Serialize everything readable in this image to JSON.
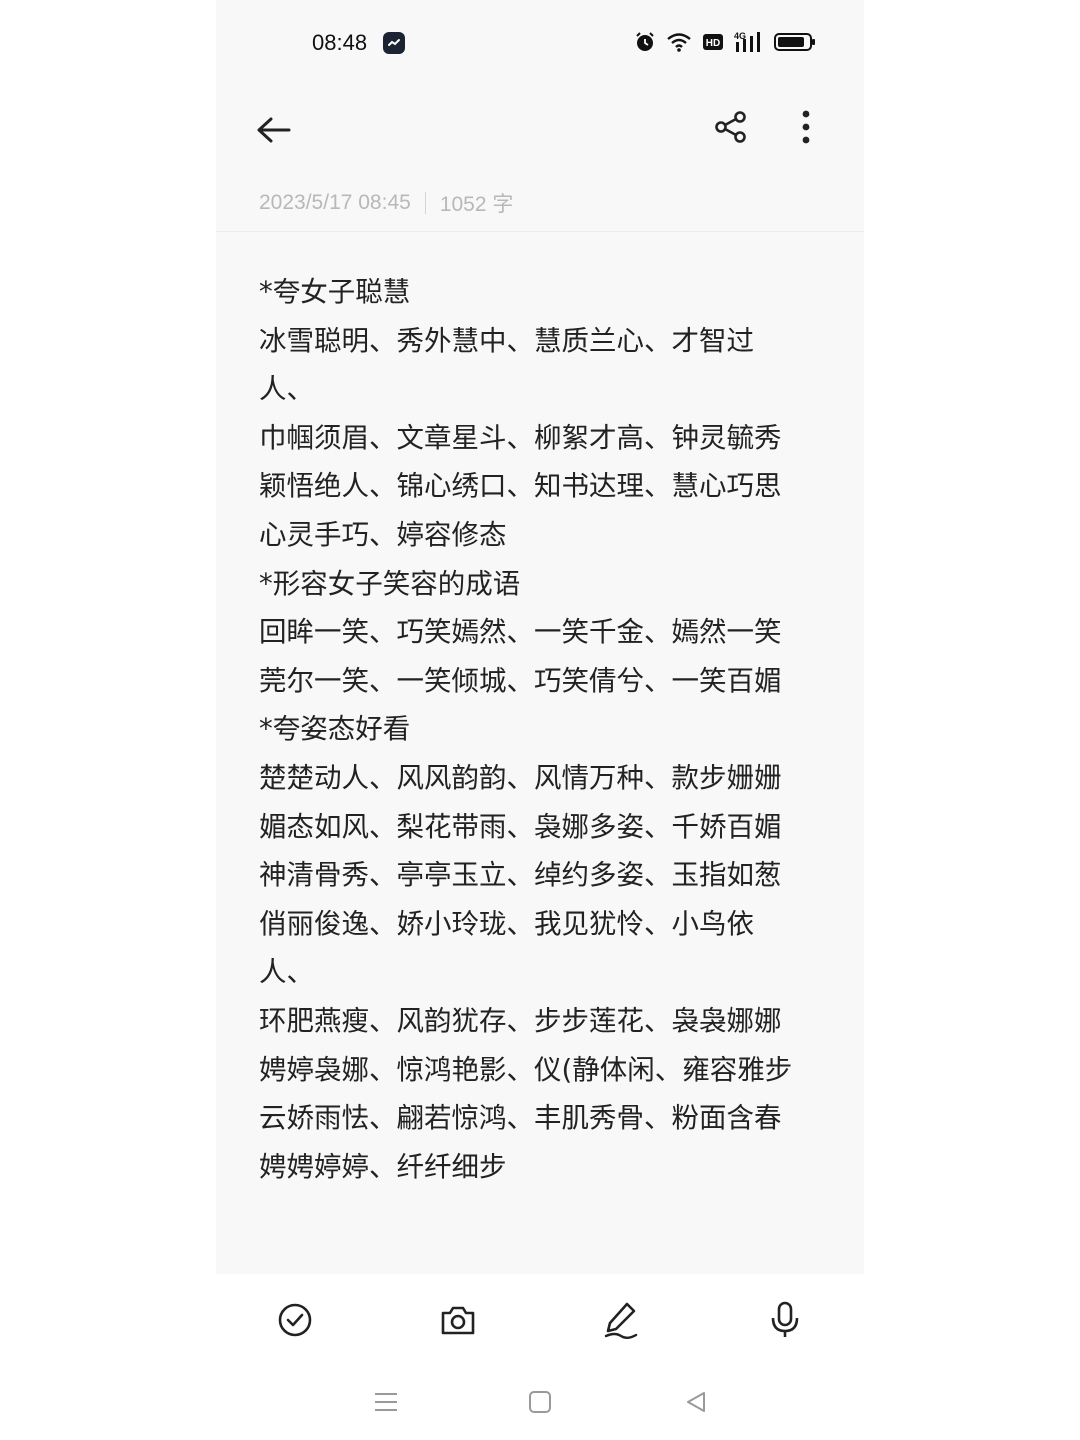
{
  "status_bar": {
    "time": "08:48",
    "icons": [
      "alarm-icon",
      "wifi-icon",
      "hd-icon",
      "4g-signal-icon",
      "battery-icon"
    ],
    "hd_label": "HD",
    "network_label": "4G"
  },
  "top_bar": {
    "back_icon": "back-arrow-icon",
    "share_icon": "share-icon",
    "more_icon": "more-vertical-icon"
  },
  "meta": {
    "datetime": "2023/5/17 08:45",
    "word_count": "1052 字"
  },
  "note": {
    "lines": [
      "*夸女子聪慧",
      "冰雪聪明、秀外慧中、慧质兰心、才智过",
      "人、",
      "巾帼须眉、文章星斗、柳絮才高、钟灵毓秀",
      "颖悟绝人、锦心绣口、知书达理、慧心巧思",
      "心灵手巧、婷容修态",
      "*形容女子笑容的成语",
      "回眸一笑、巧笑嫣然、一笑千金、嫣然一笑",
      "莞尔一笑、一笑倾城、巧笑倩兮、一笑百媚",
      "*夸姿态好看",
      "楚楚动人、风风韵韵、风情万种、款步姗姗",
      "媚态如风、梨花带雨、袅娜多姿、千娇百媚",
      "神清骨秀、亭亭玉立、绰约多姿、玉指如葱",
      "俏丽俊逸、娇小玲珑、我见犹怜、小鸟依",
      "人、",
      "环肥燕瘦、风韵犹存、步步莲花、袅袅娜娜",
      "娉婷袅娜、惊鸿艳影、仪(静体闲、雍容雅步",
      "云娇雨怯、翩若惊鸿、丰肌秀骨、粉面含春",
      "娉娉婷婷、纤纤细步"
    ]
  },
  "toolbar": {
    "items": [
      "checklist-icon",
      "camera-icon",
      "pen-icon",
      "microphone-icon"
    ]
  },
  "nav": {
    "items": [
      "menu-icon",
      "home-icon",
      "back-icon"
    ]
  },
  "colors": {
    "background": "#f8f8f8",
    "text": "#222222",
    "meta_text": "#b8b8b8"
  }
}
